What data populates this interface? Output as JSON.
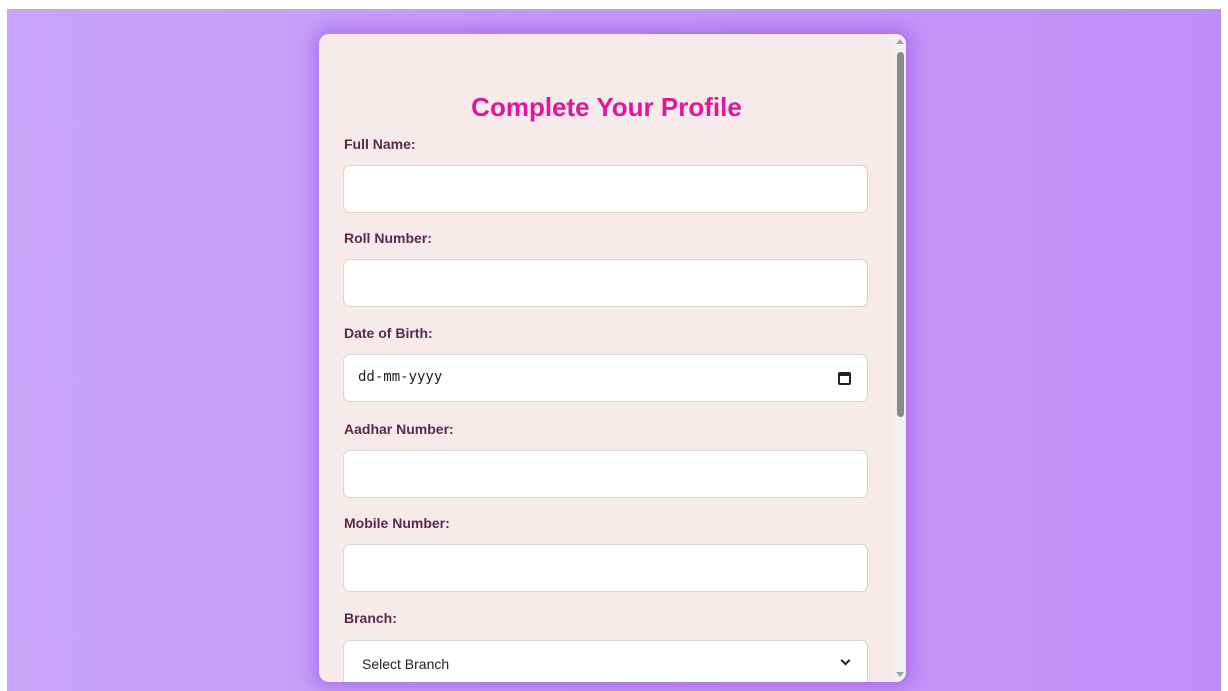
{
  "form": {
    "title": "Complete Your Profile",
    "fields": [
      {
        "label": "Full Name:",
        "type": "text",
        "value": ""
      },
      {
        "label": "Roll Number:",
        "type": "text",
        "value": ""
      },
      {
        "label": "Date of Birth:",
        "type": "date",
        "value": "dd-mm-yyyy"
      },
      {
        "label": "Aadhar Number:",
        "type": "text",
        "value": ""
      },
      {
        "label": "Mobile Number:",
        "type": "text",
        "value": ""
      },
      {
        "label": "Branch:",
        "type": "select",
        "value": "Select Branch"
      }
    ]
  },
  "colors": {
    "title": "#e3169b",
    "label": "#5a2a4a",
    "card_background": "#f6eaea",
    "page_background": "#c599f8"
  },
  "icons": {
    "date_picker": "calendar-icon",
    "select_dropdown": "chevron-down-icon",
    "scroll_up": "scroll-up-arrow-icon",
    "scroll_down": "scroll-down-arrow-icon"
  }
}
